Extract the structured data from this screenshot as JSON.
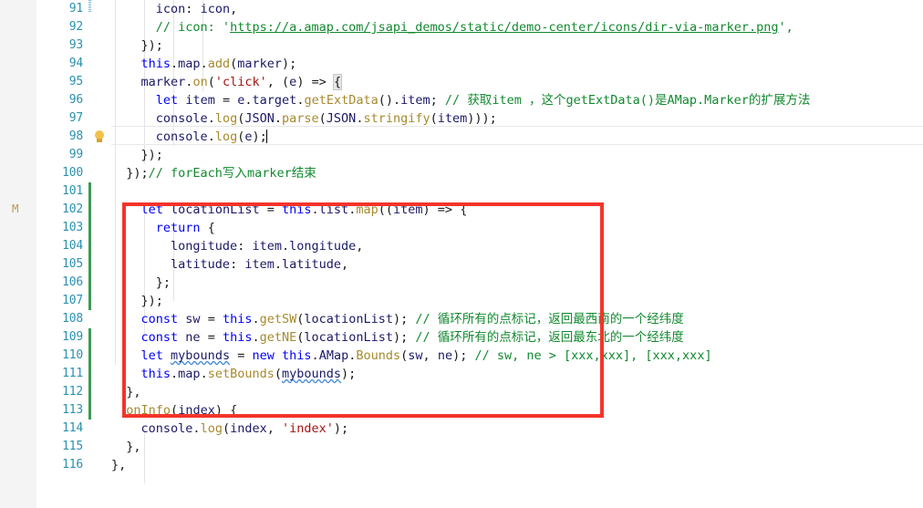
{
  "editor": {
    "modified_marker": "M",
    "bulb_icon": "lightbulb-quickfix-icon",
    "caret_line": 98,
    "colors": {
      "keyword": "#0000ff",
      "comment": "#12892f",
      "string": "#a31515",
      "function": "#a68a2d",
      "identifier": "#1a1a66",
      "linenumber": "#2b91af",
      "annotation_box": "#f4342a",
      "changebar": "#3c9a52",
      "background": "#ffffff",
      "gutter_background": "#f4f4f4"
    }
  },
  "lines": [
    {
      "n": 91,
      "text": "      icon: icon,"
    },
    {
      "n": 92,
      "text": "      // icon: 'https://a.amap.com/jsapi_demos/static/demo-center/icons/dir-via-marker.png',"
    },
    {
      "n": 93,
      "text": "    });"
    },
    {
      "n": 94,
      "text": "    this.map.add(marker);"
    },
    {
      "n": 95,
      "text": "    marker.on('click', (e) => {"
    },
    {
      "n": 96,
      "text": "      let item = e.target.getExtData().item; // 获取item ，这个getExtData()是AMap.Marker的扩展方法"
    },
    {
      "n": 97,
      "text": "      console.log(JSON.parse(JSON.stringify(item)));"
    },
    {
      "n": 98,
      "text": "      console.log(e);"
    },
    {
      "n": 99,
      "text": "    });"
    },
    {
      "n": 100,
      "text": "  });// forEach写入marker结束"
    },
    {
      "n": 101,
      "text": ""
    },
    {
      "n": 102,
      "text": "    let locationList = this.list.map((item) => {"
    },
    {
      "n": 103,
      "text": "      return {"
    },
    {
      "n": 104,
      "text": "        longitude: item.longitude,"
    },
    {
      "n": 105,
      "text": "        latitude: item.latitude,"
    },
    {
      "n": 106,
      "text": "      };"
    },
    {
      "n": 107,
      "text": "    });"
    },
    {
      "n": 108,
      "text": "    const sw = this.getSW(locationList); // 循环所有的点标记，返回最西南的一个经纬度"
    },
    {
      "n": 109,
      "text": "    const ne = this.getNE(locationList); // 循环所有的点标记，返回最东北的一个经纬度"
    },
    {
      "n": 110,
      "text": "    let mybounds = new this.AMap.Bounds(sw, ne); // sw, ne > [xxx,xxx], [xxx,xxx]"
    },
    {
      "n": 111,
      "text": "    this.map.setBounds(mybounds);"
    },
    {
      "n": 112,
      "text": "  },"
    },
    {
      "n": 113,
      "text": "  onInfo(index) {"
    },
    {
      "n": 114,
      "text": "    console.log(index, 'index');"
    },
    {
      "n": 115,
      "text": "  },"
    },
    {
      "n": 116,
      "text": "},"
    }
  ],
  "line_numbers": [
    91,
    92,
    93,
    94,
    95,
    96,
    97,
    98,
    99,
    100,
    101,
    102,
    103,
    104,
    105,
    106,
    107,
    108,
    109,
    110,
    111,
    112,
    113,
    114,
    115,
    116
  ],
  "comments": {
    "line96": "// 获取item ，这个getExtData()是AMap.Marker的扩展方法",
    "line100": "// forEach写入marker结束",
    "line108": "// 循环所有的点标记，返回最西南的一个经纬度",
    "line109": "// 循环所有的点标记，返回最东北的一个经纬度",
    "line110": "// sw, ne > [xxx,xxx], [xxx,xxx]",
    "line92_url": "https://a.amap.com/jsapi_demos/static/demo-center/icons/dir-via-marker.png"
  },
  "annotation": {
    "shape": "rectangle",
    "color": "#f4342a",
    "covers_lines": "102-111"
  }
}
